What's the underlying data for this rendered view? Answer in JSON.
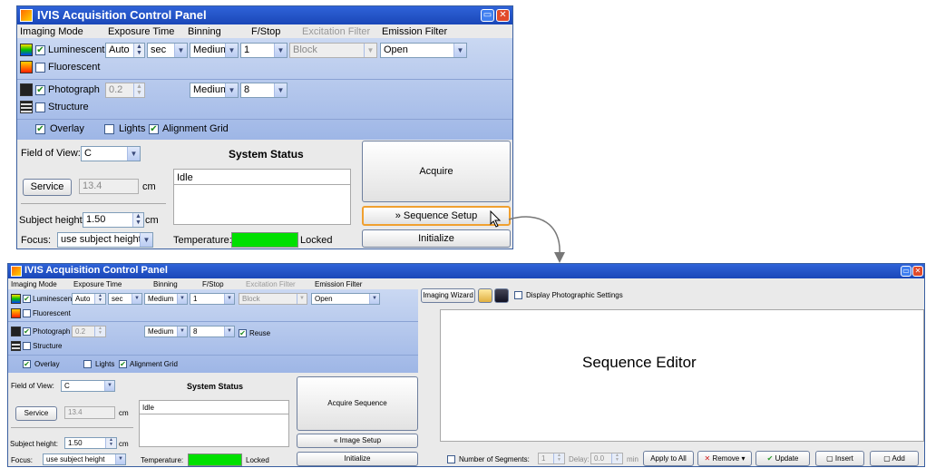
{
  "top_window": {
    "title": "IVIS Acquisition Control Panel",
    "headers": {
      "imaging_mode": "Imaging Mode",
      "exposure_time": "Exposure Time",
      "binning": "Binning",
      "fstop": "F/Stop",
      "excitation_filter": "Excitation Filter",
      "emission_filter": "Emission Filter"
    },
    "luminescent": {
      "label": "Luminescent",
      "exposure": "Auto",
      "unit": "sec",
      "binning": "Medium",
      "fstop": "1",
      "excitation": "Block",
      "emission": "Open"
    },
    "fluorescent": {
      "label": "Fluorescent"
    },
    "photograph": {
      "label": "Photograph",
      "exposure": "0.2",
      "binning": "Medium",
      "fstop": "8"
    },
    "structure": {
      "label": "Structure"
    },
    "overlay": "Overlay",
    "lights": "Lights",
    "alignment_grid": "Alignment Grid",
    "field_of_view_label": "Field of View:",
    "field_of_view": "C",
    "service": "Service",
    "service_value": "13.4",
    "service_unit": "cm",
    "subject_height_label": "Subject height:",
    "subject_height": "1.50",
    "subject_height_unit": "cm",
    "focus_label": "Focus:",
    "focus": "use subject height",
    "system_status_title": "System Status",
    "status": "Idle",
    "temperature_label": "Temperature:",
    "temperature_state": "Locked",
    "acquire": "Acquire",
    "sequence_setup": "Sequence Setup",
    "sequence_setup_chevron": "»",
    "initialize": "Initialize"
  },
  "bottom_window": {
    "title": "IVIS Acquisition Control Panel",
    "headers": {
      "imaging_mode": "Imaging Mode",
      "exposure_time": "Exposure Time",
      "binning": "Binning",
      "fstop": "F/Stop",
      "excitation_filter": "Excitation Filter",
      "emission_filter": "Emission Filter"
    },
    "luminescent": {
      "label": "Luminescent",
      "exposure": "Auto",
      "unit": "sec",
      "binning": "Medium",
      "fstop": "1",
      "excitation": "Block",
      "emission": "Open"
    },
    "fluorescent": {
      "label": "Fluorescent"
    },
    "photograph": {
      "label": "Photograph",
      "exposure": "0.2",
      "binning": "Medium",
      "fstop": "8"
    },
    "structure": {
      "label": "Structure"
    },
    "reuse": "Reuse",
    "overlay": "Overlay",
    "lights": "Lights",
    "alignment_grid": "Alignment Grid",
    "field_of_view_label": "Field of View:",
    "field_of_view": "C",
    "service": "Service",
    "service_value": "13.4",
    "service_unit": "cm",
    "subject_height_label": "Subject height:",
    "subject_height": "1.50",
    "subject_height_unit": "cm",
    "focus_label": "Focus:",
    "focus": "use subject height",
    "system_status_title": "System Status",
    "status": "Idle",
    "temperature_label": "Temperature:",
    "temperature_state": "Locked",
    "acquire_sequence": "Acquire Sequence",
    "image_setup": "Image Setup",
    "image_setup_chevron": "«",
    "initialize": "Initialize",
    "imaging_wizard": "Imaging Wizard",
    "display_photographic_settings": "Display Photographic Settings",
    "sequence_editor": "Sequence Editor",
    "number_of_segments_label": "Number of Segments:",
    "number_of_segments": "1",
    "delay_label": "Delay:",
    "delay_value": "0.0",
    "delay_unit": "min",
    "apply_to_all": "Apply to All",
    "remove": "Remove",
    "update": "Update",
    "insert": "Insert",
    "add": "Add"
  },
  "colors": {
    "title_bar": "#1a47b8",
    "panel_blue": "#9eb6e6",
    "temperature_ok": "#00e000",
    "highlight": "#f0a030"
  },
  "icons": [
    "app-icon",
    "minimize-icon",
    "close-icon",
    "checkbox-icon",
    "dropdown-arrow-icon",
    "spinner-icon",
    "save-icon",
    "open-folder-icon",
    "remove-x-icon",
    "update-check-icon",
    "insert-icon",
    "add-icon",
    "cursor-icon",
    "connector-arrow-icon"
  ]
}
